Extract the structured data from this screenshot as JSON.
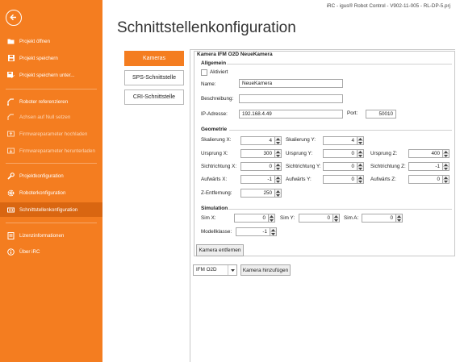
{
  "window": {
    "title": "iRC - igus® Robot Control - V902-11-005 - RL-DP-5.prj"
  },
  "sidebar": {
    "back_icon": "arrow-left-circle-icon",
    "items": [
      {
        "label": "Projekt öffnen",
        "icon": "folder-icon",
        "enabled": true,
        "active": false
      },
      {
        "label": "Projekt speichern",
        "icon": "save-icon",
        "enabled": true,
        "active": false
      },
      {
        "label": "Projekt speichern unter...",
        "icon": "save-as-icon",
        "enabled": true,
        "active": false
      },
      {
        "label": "Roboter referenzieren",
        "icon": "reference-icon",
        "enabled": true,
        "active": false
      },
      {
        "label": "Achsen auf Null setzen",
        "icon": "zero-axes-icon",
        "enabled": false,
        "active": false
      },
      {
        "label": "Firmwareparameter hochladen",
        "icon": "upload-icon",
        "enabled": false,
        "active": false
      },
      {
        "label": "Firmwareparameter herunterladen",
        "icon": "download-icon",
        "enabled": false,
        "active": false
      },
      {
        "label": "Projektkonfiguration",
        "icon": "wrench-icon",
        "enabled": true,
        "active": false
      },
      {
        "label": "Roboterkonfiguration",
        "icon": "gear-icon",
        "enabled": true,
        "active": false
      },
      {
        "label": "Schnittstellenkonfiguration",
        "icon": "interface-icon",
        "enabled": true,
        "active": true
      },
      {
        "label": "Lizenzinformationen",
        "icon": "license-icon",
        "enabled": true,
        "active": false
      },
      {
        "label": "Über iRC",
        "icon": "info-icon",
        "enabled": true,
        "active": false
      }
    ]
  },
  "page": {
    "title": "Schnittstellenkonfiguration"
  },
  "tabs": [
    {
      "label": "Kameras",
      "active": true
    },
    {
      "label": "SPS-Schnittstelle",
      "active": false
    },
    {
      "label": "CRI-Schnittstelle",
      "active": false
    }
  ],
  "camera": {
    "box_title": "Kamera IFM O2D NeueKamera",
    "general": {
      "title": "Allgemein",
      "activated_label": "Aktiviert",
      "activated": false,
      "name_label": "Name:",
      "name_value": "NeueKamera",
      "description_label": "Beschreibung:",
      "description_value": "",
      "ip_label": "IP-Adresse:",
      "ip_value": "192.168.4.49",
      "port_label": "Port:",
      "port_value": "50010"
    },
    "geometry": {
      "title": "Geometrie",
      "fields": [
        {
          "label": "Skalierung X:",
          "value": "4"
        },
        {
          "label": "Skalierung Y:",
          "value": "4"
        },
        {
          "label": "Ursprung X:",
          "value": "300"
        },
        {
          "label": "Ursprung Y:",
          "value": "0"
        },
        {
          "label": "Ursprung Z:",
          "value": "400"
        },
        {
          "label": "Sichtrichtung X:",
          "value": "0"
        },
        {
          "label": "Sichtrichtung Y:",
          "value": "0"
        },
        {
          "label": "Sichtrichtung Z:",
          "value": "-1"
        },
        {
          "label": "Aufwärts X:",
          "value": "-1"
        },
        {
          "label": "Aufwärts Y:",
          "value": "0"
        },
        {
          "label": "Aufwärts Z:",
          "value": "0"
        },
        {
          "label": "Z-Entfernung:",
          "value": "250"
        }
      ]
    },
    "simulation": {
      "title": "Simulation",
      "fields": [
        {
          "label": "Sim X:",
          "value": "0"
        },
        {
          "label": "Sim Y:",
          "value": "0"
        },
        {
          "label": "Sim A:",
          "value": "0"
        },
        {
          "label": "Modellklasse:",
          "value": "-1"
        }
      ]
    },
    "remove_button": "Kamera entfernen"
  },
  "footer": {
    "camera_type_value": "IFM O2D",
    "add_button": "Kamera hinzufügen"
  },
  "colors": {
    "accent": "#f47d20",
    "accent_active": "#d96611"
  }
}
